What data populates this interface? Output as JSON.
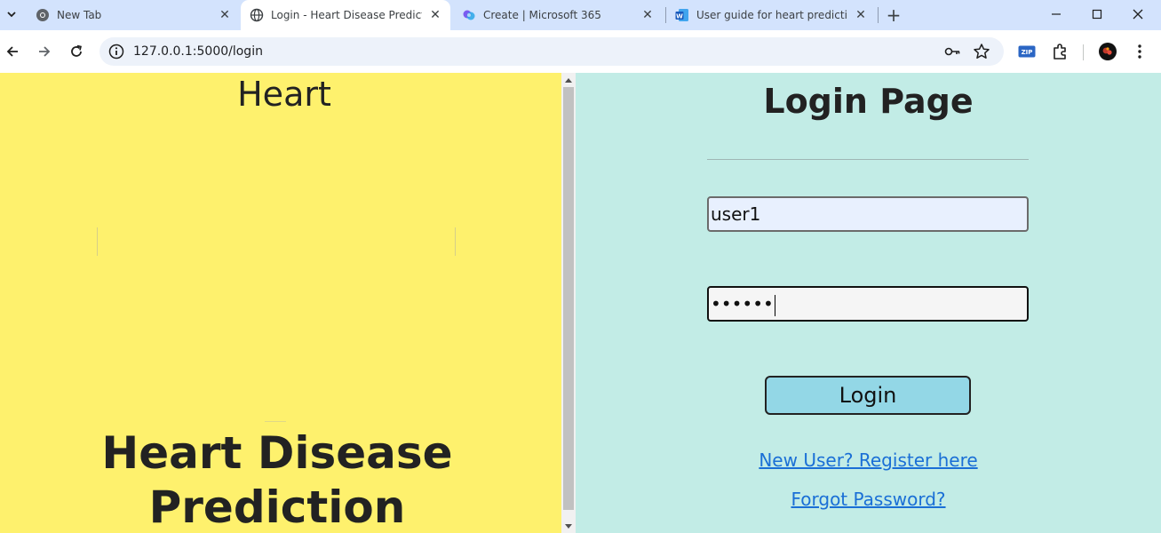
{
  "browser": {
    "tabs": [
      {
        "title": "New Tab",
        "icon": "chrome-icon"
      },
      {
        "title": "Login - Heart Disease Prediction",
        "icon": "globe-icon",
        "active": true
      },
      {
        "title": "Create | Microsoft 365",
        "icon": "copilot-icon"
      },
      {
        "title": "User guide for heart prediction",
        "icon": "word-icon"
      }
    ],
    "new_tab": "+",
    "close_glyph": "✕",
    "url": "127.0.0.1:5000/login",
    "window_controls": [
      "minimize",
      "maximize",
      "close"
    ],
    "extension_badge": "ZIP"
  },
  "left": {
    "heading": "Heart",
    "title_line1": "Heart Disease",
    "title_line2": "Prediction"
  },
  "login": {
    "title": "Login Page",
    "username_value": "user1",
    "password_value": "••••••",
    "button_label": "Login",
    "register_link": "New User? Register here",
    "forgot_link": "Forgot Password?"
  },
  "colors": {
    "left_bg": "#fef16d",
    "right_bg": "#c2ece6",
    "button_bg": "#93d7e6",
    "link": "#1a6fd6",
    "tabbar": "#d3e3fd"
  }
}
